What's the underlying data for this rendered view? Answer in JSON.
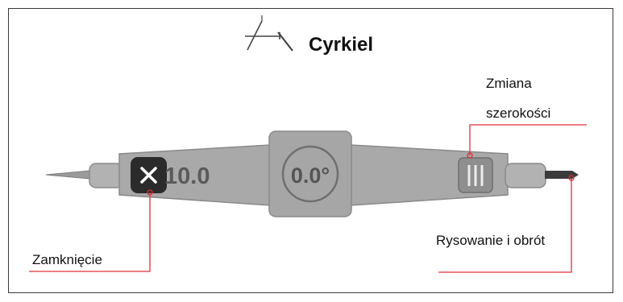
{
  "title": "Cyrkiel",
  "icons": {
    "title": "compass-icon",
    "close": "close-icon",
    "width_handle": "width-grip-icon",
    "pen": "pen-tip-icon"
  },
  "readouts": {
    "width": "10.0",
    "angle": "0.0°"
  },
  "labels": {
    "width_change_line1": "Zmiana",
    "width_change_line2": "szerokości",
    "draw_rotate": "Rysowanie i obrót",
    "close": "Zamknięcie"
  },
  "colors": {
    "callout_line": "#e0303a",
    "body": "#a9a9a9",
    "body_edge": "#8a8a8a",
    "close_bg": "#2b2b2b"
  }
}
